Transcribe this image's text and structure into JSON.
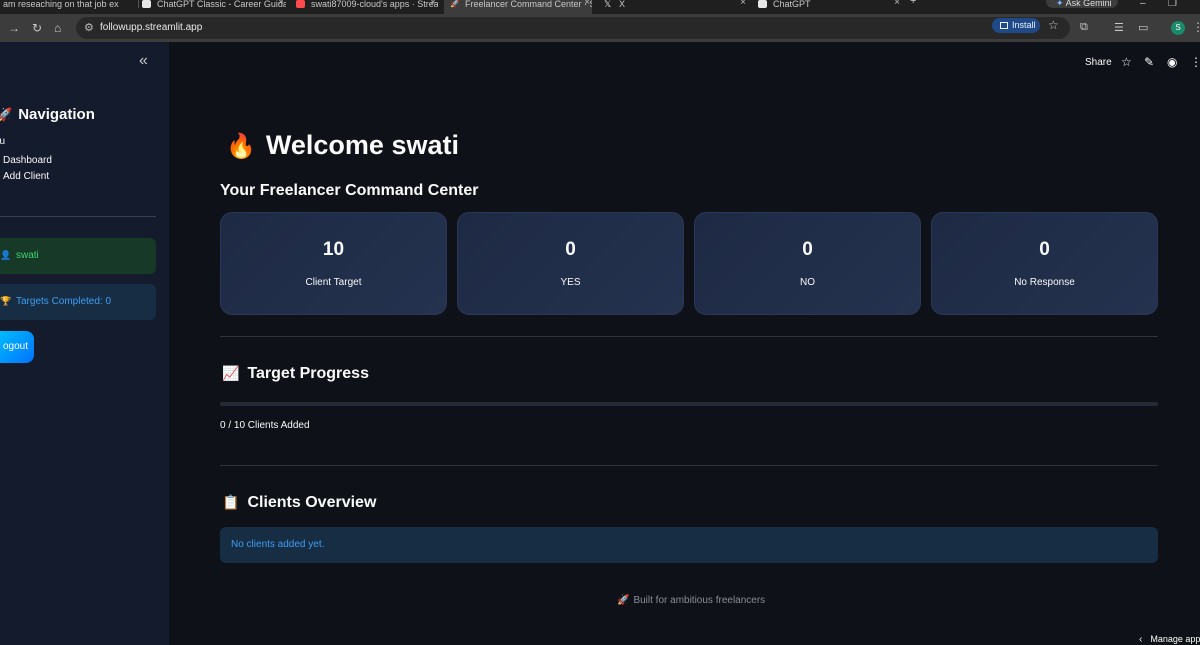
{
  "browser": {
    "tabs": [
      {
        "label": "I am reseaching on that job ex",
        "favicon_color": "#9aa0a6"
      },
      {
        "label": "ChatGPT Classic - Career Guida",
        "favicon_color": "#e8e8e8"
      },
      {
        "label": "swati87009-cloud's apps · Strea",
        "favicon_color": "#ff4b4b"
      },
      {
        "label": "Freelancer Command Center · S",
        "favicon_color": "#9aa0a6"
      },
      {
        "label": "X",
        "favicon_color": "#e8e8e8"
      },
      {
        "label": "ChatGPT",
        "favicon_color": "#e8e8e8"
      }
    ],
    "new_tab_icon": "+",
    "gemini_label": "Ask Gemini",
    "url": "followupp.streamlit.app",
    "install_label": "Install",
    "profile_initial": "S"
  },
  "sidebar": {
    "collapse_icon": "«",
    "nav_icon": "🚀",
    "nav_title": "Navigation",
    "menu_label": "nu",
    "menu_items": [
      "Dashboard",
      "Add Client"
    ],
    "user_icon": "👤",
    "user_name": "swati",
    "target_icon": "🏆",
    "targets_completed": "Targets Completed: 0",
    "logout_label": "ogout"
  },
  "header": {
    "share_label": "Share"
  },
  "main": {
    "welcome_icon": "🔥",
    "welcome_title": "Welcome swati",
    "subtitle": "Your Freelancer Command Center",
    "cards": [
      {
        "value": "10",
        "label": "Client Target"
      },
      {
        "value": "0",
        "label": "YES"
      },
      {
        "value": "0",
        "label": "NO"
      },
      {
        "value": "0",
        "label": "No Response"
      }
    ],
    "progress_icon": "📈",
    "progress_title": "Target Progress",
    "progress_fraction": 0,
    "progress_text": "0 / 10 Clients Added",
    "clients_icon": "📋",
    "clients_title": "Clients Overview",
    "clients_empty": "No clients added yet.",
    "footer_icon": "🚀",
    "footer_text": "Built for ambitious freelancers",
    "manage_label": "Manage app"
  },
  "colors": {
    "app_bg": "#0e1117",
    "sidebar_bg": "#141b2d",
    "success_text": "#3dd56d",
    "info_text": "#3d9df3"
  }
}
